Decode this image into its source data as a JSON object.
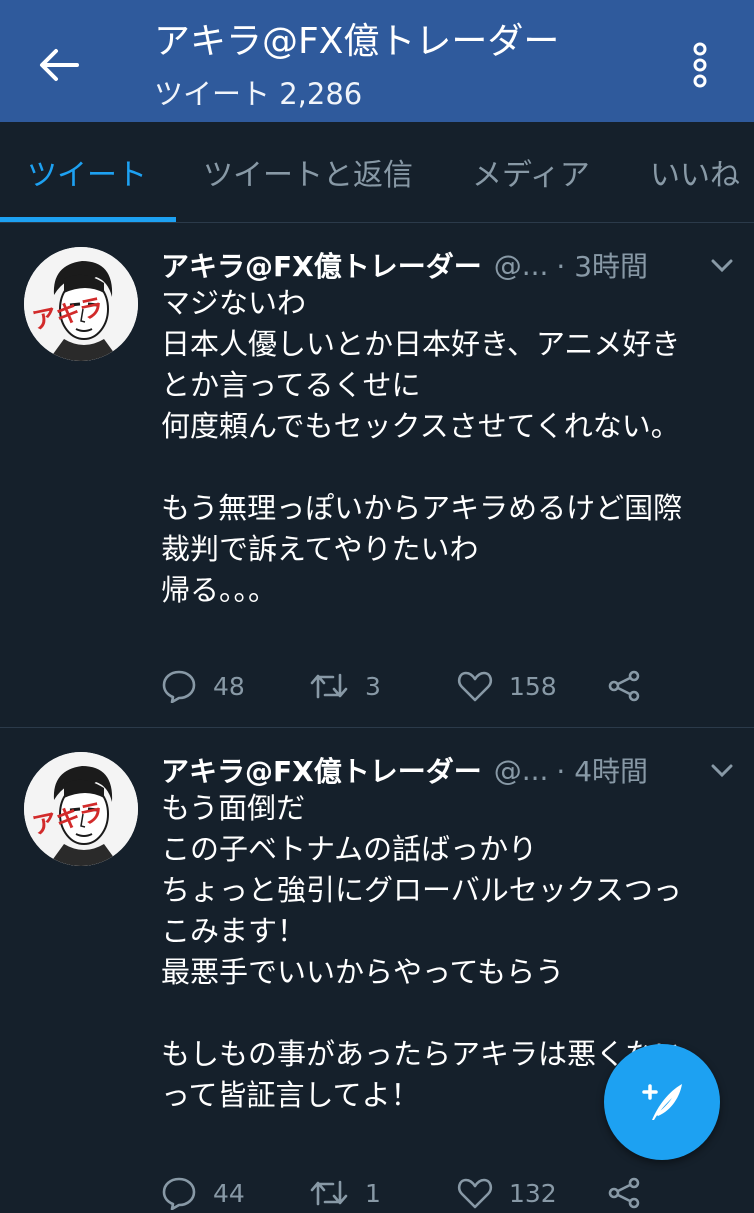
{
  "header": {
    "title": "アキラ@FX億トレーダー",
    "subtitle": "ツイート 2,286",
    "bg_color": "#2f5a9c"
  },
  "tabs": [
    {
      "label": "ツイート",
      "active": true
    },
    {
      "label": "ツイートと返信",
      "active": false
    },
    {
      "label": "メディア",
      "active": false
    },
    {
      "label": "いいね",
      "active": false
    }
  ],
  "accent_color": "#1da1f2",
  "tweets": [
    {
      "display_name": "アキラ@FX億トレーダー",
      "handle": "@...",
      "time": "· 3時間",
      "avatar_text": "アキラ",
      "lines": [
        "マジないわ",
        "日本人優しいとか日本好き、アニメ好き",
        "とか言ってるくせに",
        "何度頼んでもセックスさせてくれない。",
        "",
        "もう無理っぽいからアキラめるけど国際",
        "裁判で訴えてやりたいわ",
        "帰る。。。"
      ],
      "replies": "48",
      "retweets": "3",
      "likes": "158"
    },
    {
      "display_name": "アキラ@FX億トレーダー",
      "handle": "@...",
      "time": "· 4時間",
      "avatar_text": "アキラ",
      "lines": [
        "もう面倒だ",
        "この子ベトナムの話ばっかり",
        "ちょっと強引にグローバルセックスつっ",
        "こみます！",
        "最悪手でいいからやってもらう",
        "",
        "もしもの事があったらアキラは悪くない",
        "って皆証言してよ！"
      ],
      "replies": "44",
      "retweets": "1",
      "likes": "132"
    }
  ],
  "icons": {
    "back": "arrow-left-icon",
    "more": "more-vertical-icon",
    "caret": "chevron-down-icon",
    "reply": "reply-icon",
    "retweet": "retweet-icon",
    "like": "heart-icon",
    "share": "share-icon",
    "compose": "compose-tweet-icon"
  }
}
